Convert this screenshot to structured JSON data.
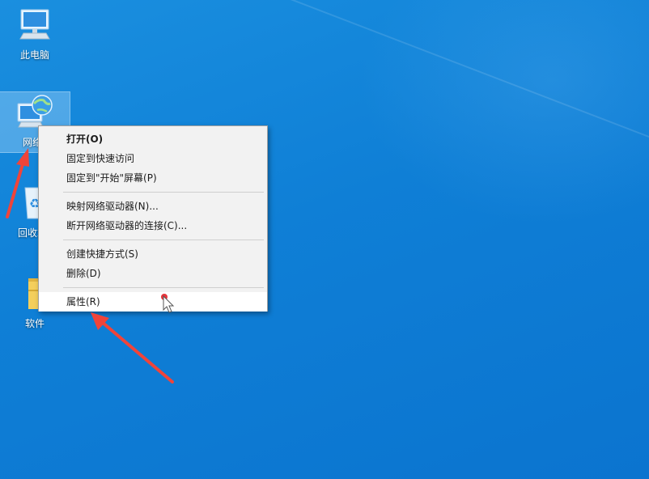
{
  "desktop": {
    "icons": [
      {
        "label": "此电脑",
        "icon": "computer-icon"
      },
      {
        "label": "网络",
        "icon": "network-icon"
      },
      {
        "label": "回收站",
        "icon": "recycle-bin-icon"
      },
      {
        "label": "软件",
        "icon": "folder-icon"
      }
    ]
  },
  "context_menu": {
    "items": [
      {
        "label": "打开(O)",
        "bold": true
      },
      {
        "label": "固定到快速访问"
      },
      {
        "label": "固定到\"开始\"屏幕(P)"
      },
      {
        "label": "映射网络驱动器(N)..."
      },
      {
        "label": "断开网络驱动器的连接(C)..."
      },
      {
        "label": "创建快捷方式(S)"
      },
      {
        "label": "删除(D)"
      },
      {
        "label": "属性(R)",
        "hovered": true
      }
    ]
  },
  "colors": {
    "desktop_bg": "#0f7fd6",
    "menu_bg": "#f2f2f2",
    "annotation_arrow": "#f0443a"
  }
}
